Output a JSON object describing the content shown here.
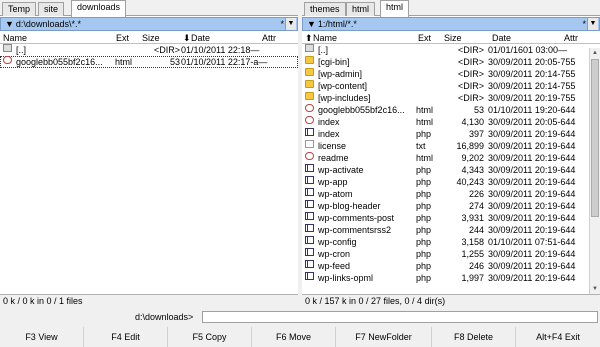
{
  "left": {
    "tabs": [
      "Temp",
      "site",
      "downloads"
    ],
    "active_tab": 2,
    "path_arrow": "▼",
    "path": "d:\\downloads\\*.*",
    "filter_star": "*",
    "drop_arrow": "▼",
    "columns": {
      "name": "Name",
      "ext": "Ext",
      "size": "Size",
      "date": "Date",
      "attr": "Attr",
      "sort_arrow": "⬇"
    },
    "rows": [
      {
        "icon": "up",
        "name": "[..]",
        "ext": "",
        "size": "<DIR>",
        "date": "01/10/2011 22:18—",
        "attr": ""
      },
      {
        "icon": "html",
        "name": "googlebb055bf2c16...",
        "ext": "html",
        "size": "53",
        "date": "01/10/2011 22:17-a—",
        "attr": "",
        "selected": true
      }
    ],
    "status": "0 k / 0 k in 0 / 1 files"
  },
  "right": {
    "tabs": [
      "themes",
      "html",
      "html"
    ],
    "active_tab": 2,
    "path_arrow": "▼",
    "path": "1:/html/*.*",
    "filter_star": "*",
    "drop_arrow": "▼",
    "columns": {
      "name": "Name",
      "ext": "Ext",
      "size": "Size",
      "date": "Date",
      "attr": "Attr",
      "sort_arrow": "⬆"
    },
    "rows": [
      {
        "icon": "up",
        "name": "[..]",
        "ext": "",
        "size": "<DIR>",
        "date": "01/01/1601 03:00—",
        "attr": ""
      },
      {
        "icon": "folder",
        "name": "[cgi-bin]",
        "ext": "",
        "size": "<DIR>",
        "date": "30/09/2011 20:05-755",
        "attr": ""
      },
      {
        "icon": "folder",
        "name": "[wp-admin]",
        "ext": "",
        "size": "<DIR>",
        "date": "30/09/2011 20:14-755",
        "attr": ""
      },
      {
        "icon": "folder",
        "name": "[wp-content]",
        "ext": "",
        "size": "<DIR>",
        "date": "30/09/2011 20:14-755",
        "attr": ""
      },
      {
        "icon": "folder",
        "name": "[wp-includes]",
        "ext": "",
        "size": "<DIR>",
        "date": "30/09/2011 20:19-755",
        "attr": ""
      },
      {
        "icon": "html",
        "name": "googlebb055bf2c16...",
        "ext": "html",
        "size": "53",
        "date": "01/10/2011 19:20-644",
        "attr": ""
      },
      {
        "icon": "html",
        "name": "index",
        "ext": "html",
        "size": "4,130",
        "date": "30/09/2011 20:05-644",
        "attr": ""
      },
      {
        "icon": "php",
        "name": "index",
        "ext": "php",
        "size": "397",
        "date": "30/09/2011 20:19-644",
        "attr": ""
      },
      {
        "icon": "txt",
        "name": "license",
        "ext": "txt",
        "size": "16,899",
        "date": "30/09/2011 20:19-644",
        "attr": ""
      },
      {
        "icon": "html",
        "name": "readme",
        "ext": "html",
        "size": "9,202",
        "date": "30/09/2011 20:19-644",
        "attr": ""
      },
      {
        "icon": "php",
        "name": "wp-activate",
        "ext": "php",
        "size": "4,343",
        "date": "30/09/2011 20:19-644",
        "attr": ""
      },
      {
        "icon": "php",
        "name": "wp-app",
        "ext": "php",
        "size": "40,243",
        "date": "30/09/2011 20:19-644",
        "attr": ""
      },
      {
        "icon": "php",
        "name": "wp-atom",
        "ext": "php",
        "size": "226",
        "date": "30/09/2011 20:19-644",
        "attr": ""
      },
      {
        "icon": "php",
        "name": "wp-blog-header",
        "ext": "php",
        "size": "274",
        "date": "30/09/2011 20:19-644",
        "attr": ""
      },
      {
        "icon": "php",
        "name": "wp-comments-post",
        "ext": "php",
        "size": "3,931",
        "date": "30/09/2011 20:19-644",
        "attr": ""
      },
      {
        "icon": "php",
        "name": "wp-commentsrss2",
        "ext": "php",
        "size": "244",
        "date": "30/09/2011 20:19-644",
        "attr": ""
      },
      {
        "icon": "php",
        "name": "wp-config",
        "ext": "php",
        "size": "3,158",
        "date": "01/10/2011 07:51-644",
        "attr": ""
      },
      {
        "icon": "php",
        "name": "wp-cron",
        "ext": "php",
        "size": "1,255",
        "date": "30/09/2011 20:19-644",
        "attr": ""
      },
      {
        "icon": "php",
        "name": "wp-feed",
        "ext": "php",
        "size": "246",
        "date": "30/09/2011 20:19-644",
        "attr": ""
      },
      {
        "icon": "php",
        "name": "wp-links-opml",
        "ext": "php",
        "size": "1,997",
        "date": "30/09/2011 20:19-644",
        "attr": ""
      }
    ],
    "status": "0 k / 157 k in 0 / 27 files, 0 / 4 dir(s)"
  },
  "command_line": {
    "label": "d:\\downloads>",
    "value": ""
  },
  "function_keys": [
    "F3 View",
    "F4 Edit",
    "F5 Copy",
    "F6 Move",
    "F7 NewFolder",
    "F8 Delete",
    "Alt+F4 Exit"
  ],
  "colors": {
    "path_bar": "#a6c8f0",
    "folder": "#f5c842"
  }
}
